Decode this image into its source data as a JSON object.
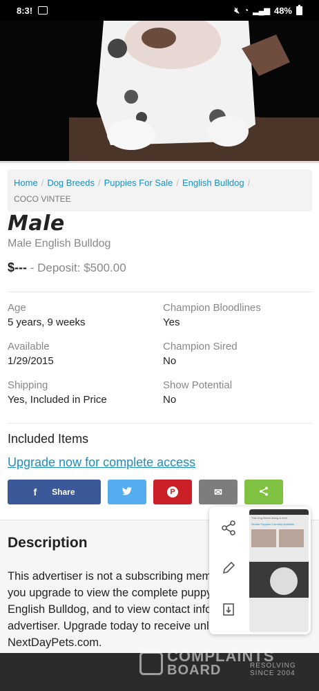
{
  "status_bar": {
    "time": "8:3!",
    "battery": "48%"
  },
  "breadcrumb": {
    "items": [
      "Home",
      "Dog Breeds",
      "Puppies For Sale",
      "English Bulldog"
    ],
    "current": "COCO VINTEE"
  },
  "listing": {
    "title": "Male",
    "subtitle": "Male English Bulldog",
    "price": "$---",
    "deposit": "- Deposit: $500.00"
  },
  "details": [
    {
      "label": "Age",
      "value": "5 years, 9 weeks"
    },
    {
      "label": "Champion Bloodlines",
      "value": "Yes"
    },
    {
      "label": "Available",
      "value": "1/29/2015"
    },
    {
      "label": "Champion Sired",
      "value": "No"
    },
    {
      "label": "Shipping",
      "value": "Yes, Included in Price"
    },
    {
      "label": "Show Potential",
      "value": "No"
    }
  ],
  "included": {
    "heading": "Included Items",
    "upgrade_link": "Upgrade now for complete access"
  },
  "share": {
    "facebook_label": "Share",
    "facebook_glyph": "f",
    "twitter_glyph": "🐦",
    "pinterest_glyph": "P",
    "email_glyph": "✉",
    "share_glyph": "<"
  },
  "description": {
    "heading": "Description",
    "text": "This advertiser is not a subscribing member and asks that you upgrade to view the complete puppy profile for this English Bulldog, and to view contact information for the advertiser. Upgrade today to receive unlimited access to NextDayPets.com."
  },
  "watermark": {
    "line1": "COMPLAINTS",
    "line2": "BOARD",
    "side1": "RESOLVING",
    "side2": "SINCE 2004"
  },
  "colors": {
    "link": "#1a8fc4",
    "facebook": "#3b5998",
    "twitter": "#55acee",
    "pinterest": "#cb2027",
    "email": "#7d7d7d",
    "share": "#7fc241"
  }
}
